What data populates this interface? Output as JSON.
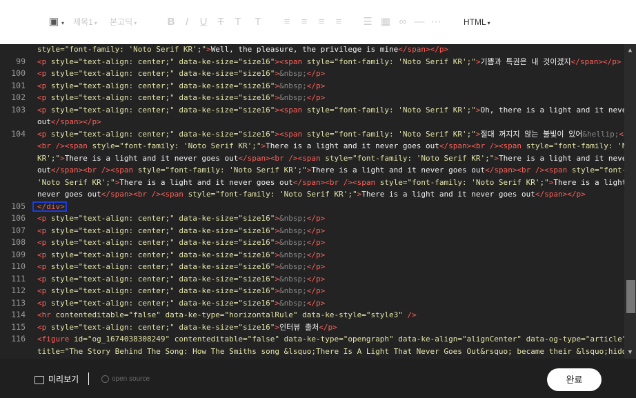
{
  "toolbar": {
    "heading_label": "제목1",
    "font_label": "본고딕",
    "mode_label": "HTML"
  },
  "editor": {
    "lines": [
      {
        "n": "",
        "segs": [
          [
            "attr",
            "style="
          ],
          [
            "str",
            "\"font-family: 'Noto Serif KR';\""
          ],
          [
            "tag",
            ">"
          ],
          [
            "txt",
            "Well, the pleasure, the privilege is mine"
          ],
          [
            "tag",
            "</span></p>"
          ]
        ]
      },
      {
        "n": "99",
        "segs": [
          [
            "tag",
            "<p "
          ],
          [
            "attr",
            "style="
          ],
          [
            "str",
            "\"text-align: center;\" "
          ],
          [
            "attr",
            "data-ke-size="
          ],
          [
            "str",
            "\"size16\""
          ],
          [
            "tag",
            "><span "
          ],
          [
            "attr",
            "style="
          ],
          [
            "str",
            "\"font-family: 'Noto Serif KR';\""
          ],
          [
            "tag",
            ">"
          ],
          [
            "txt",
            "기쁨과 특권은 내 것이겠지"
          ],
          [
            "tag",
            "</span></p>"
          ]
        ]
      },
      {
        "n": "100",
        "segs": [
          [
            "tag",
            "<p "
          ],
          [
            "attr",
            "style="
          ],
          [
            "str",
            "\"text-align: center;\" "
          ],
          [
            "attr",
            "data-ke-size="
          ],
          [
            "str",
            "\"size16\""
          ],
          [
            "tag",
            ">"
          ],
          [
            "ent",
            "&nbsp;"
          ],
          [
            "tag",
            "</p>"
          ]
        ]
      },
      {
        "n": "101",
        "segs": [
          [
            "tag",
            "<p "
          ],
          [
            "attr",
            "style="
          ],
          [
            "str",
            "\"text-align: center;\" "
          ],
          [
            "attr",
            "data-ke-size="
          ],
          [
            "str",
            "\"size16\""
          ],
          [
            "tag",
            ">"
          ],
          [
            "ent",
            "&nbsp;"
          ],
          [
            "tag",
            "</p>"
          ]
        ]
      },
      {
        "n": "102",
        "segs": [
          [
            "tag",
            "<p "
          ],
          [
            "attr",
            "style="
          ],
          [
            "str",
            "\"text-align: center;\" "
          ],
          [
            "attr",
            "data-ke-size="
          ],
          [
            "str",
            "\"size16\""
          ],
          [
            "tag",
            ">"
          ],
          [
            "ent",
            "&nbsp;"
          ],
          [
            "tag",
            "</p>"
          ]
        ]
      },
      {
        "n": "103",
        "segs": [
          [
            "tag",
            "<p "
          ],
          [
            "attr",
            "style="
          ],
          [
            "str",
            "\"text-align: center;\" "
          ],
          [
            "attr",
            "data-ke-size="
          ],
          [
            "str",
            "\"size16\""
          ],
          [
            "tag",
            "><span "
          ],
          [
            "attr",
            "style="
          ],
          [
            "str",
            "\"font-family: 'Noto Serif KR';\""
          ],
          [
            "tag",
            ">"
          ],
          [
            "txt",
            "Oh, there is a light and it never goes"
          ]
        ]
      },
      {
        "n": "",
        "segs": [
          [
            "txt",
            "out"
          ],
          [
            "tag",
            "</span></p>"
          ]
        ]
      },
      {
        "n": "104",
        "segs": [
          [
            "tag",
            "<p "
          ],
          [
            "attr",
            "style="
          ],
          [
            "str",
            "\"text-align: center;\" "
          ],
          [
            "attr",
            "data-ke-size="
          ],
          [
            "str",
            "\"size16\""
          ],
          [
            "tag",
            "><span "
          ],
          [
            "attr",
            "style="
          ],
          [
            "str",
            "\"font-family: 'Noto Serif KR';\""
          ],
          [
            "tag",
            ">"
          ],
          [
            "txt",
            "절대 꺼지지 않는 불빛이 있어"
          ],
          [
            "ent",
            "&hellip;"
          ],
          [
            "tag",
            "</span>"
          ]
        ]
      },
      {
        "n": "",
        "segs": [
          [
            "tag",
            "<br /><span "
          ],
          [
            "attr",
            "style="
          ],
          [
            "str",
            "\"font-family: 'Noto Serif KR';\""
          ],
          [
            "tag",
            ">"
          ],
          [
            "txt",
            "There is a light and it never goes out"
          ],
          [
            "tag",
            "</span><br /><span "
          ],
          [
            "attr",
            "style="
          ],
          [
            "str",
            "\"font-family: 'Noto Serif"
          ]
        ]
      },
      {
        "n": "",
        "segs": [
          [
            "str",
            "KR';\""
          ],
          [
            "tag",
            ">"
          ],
          [
            "txt",
            "There is a light and it never goes out"
          ],
          [
            "tag",
            "</span><br /><span "
          ],
          [
            "attr",
            "style="
          ],
          [
            "str",
            "\"font-family: 'Noto Serif KR';\""
          ],
          [
            "tag",
            ">"
          ],
          [
            "txt",
            "There is a light and it never goes"
          ]
        ]
      },
      {
        "n": "",
        "segs": [
          [
            "txt",
            "out"
          ],
          [
            "tag",
            "</span><br /><span "
          ],
          [
            "attr",
            "style="
          ],
          [
            "str",
            "\"font-family: 'Noto Serif KR';\""
          ],
          [
            "tag",
            ">"
          ],
          [
            "txt",
            "There is a light and it never goes out"
          ],
          [
            "tag",
            "</span><br /><span "
          ],
          [
            "attr",
            "style="
          ],
          [
            "str",
            "\"font-family:"
          ]
        ]
      },
      {
        "n": "",
        "segs": [
          [
            "str",
            "'Noto Serif KR';\""
          ],
          [
            "tag",
            ">"
          ],
          [
            "txt",
            "There is a light and it never goes out"
          ],
          [
            "tag",
            "</span><br /><span "
          ],
          [
            "attr",
            "style="
          ],
          [
            "str",
            "\"font-family: 'Noto Serif KR';\""
          ],
          [
            "tag",
            ">"
          ],
          [
            "txt",
            "There is a light and it"
          ]
        ]
      },
      {
        "n": "",
        "segs": [
          [
            "txt",
            "never goes out"
          ],
          [
            "tag",
            "</span><br /><span "
          ],
          [
            "attr",
            "style="
          ],
          [
            "str",
            "\"font-family: 'Noto Serif KR';\""
          ],
          [
            "tag",
            ">"
          ],
          [
            "txt",
            "There is a light and it never goes out"
          ],
          [
            "tag",
            "</span></p>"
          ]
        ]
      },
      {
        "n": "105",
        "segs": [
          [
            "tag",
            "</div>"
          ]
        ]
      },
      {
        "n": "106",
        "segs": [
          [
            "tag",
            "<p "
          ],
          [
            "attr",
            "style="
          ],
          [
            "str",
            "\"text-align: center;\" "
          ],
          [
            "attr",
            "data-ke-size="
          ],
          [
            "str",
            "\"size16\""
          ],
          [
            "tag",
            ">"
          ],
          [
            "ent",
            "&nbsp;"
          ],
          [
            "tag",
            "</p>"
          ]
        ]
      },
      {
        "n": "107",
        "segs": [
          [
            "tag",
            "<p "
          ],
          [
            "attr",
            "style="
          ],
          [
            "str",
            "\"text-align: center;\" "
          ],
          [
            "attr",
            "data-ke-size="
          ],
          [
            "str",
            "\"size16\""
          ],
          [
            "tag",
            ">"
          ],
          [
            "ent",
            "&nbsp;"
          ],
          [
            "tag",
            "</p>"
          ]
        ]
      },
      {
        "n": "108",
        "segs": [
          [
            "tag",
            "<p "
          ],
          [
            "attr",
            "style="
          ],
          [
            "str",
            "\"text-align: center;\" "
          ],
          [
            "attr",
            "data-ke-size="
          ],
          [
            "str",
            "\"size16\""
          ],
          [
            "tag",
            ">"
          ],
          [
            "ent",
            "&nbsp;"
          ],
          [
            "tag",
            "</p>"
          ]
        ]
      },
      {
        "n": "109",
        "segs": [
          [
            "tag",
            "<p "
          ],
          [
            "attr",
            "style="
          ],
          [
            "str",
            "\"text-align: center;\" "
          ],
          [
            "attr",
            "data-ke-size="
          ],
          [
            "str",
            "\"size16\""
          ],
          [
            "tag",
            ">"
          ],
          [
            "ent",
            "&nbsp;"
          ],
          [
            "tag",
            "</p>"
          ]
        ]
      },
      {
        "n": "110",
        "segs": [
          [
            "tag",
            "<p "
          ],
          [
            "attr",
            "style="
          ],
          [
            "str",
            "\"text-align: center;\" "
          ],
          [
            "attr",
            "data-ke-size="
          ],
          [
            "str",
            "\"size16\""
          ],
          [
            "tag",
            ">"
          ],
          [
            "ent",
            "&nbsp;"
          ],
          [
            "tag",
            "</p>"
          ]
        ]
      },
      {
        "n": "111",
        "segs": [
          [
            "tag",
            "<p "
          ],
          [
            "attr",
            "style="
          ],
          [
            "str",
            "\"text-align: center;\" "
          ],
          [
            "attr",
            "data-ke-size="
          ],
          [
            "str",
            "\"size16\""
          ],
          [
            "tag",
            ">"
          ],
          [
            "ent",
            "&nbsp;"
          ],
          [
            "tag",
            "</p>"
          ]
        ]
      },
      {
        "n": "112",
        "segs": [
          [
            "tag",
            "<p "
          ],
          [
            "attr",
            "style="
          ],
          [
            "str",
            "\"text-align: center;\" "
          ],
          [
            "attr",
            "data-ke-size="
          ],
          [
            "str",
            "\"size16\""
          ],
          [
            "tag",
            ">"
          ],
          [
            "ent",
            "&nbsp;"
          ],
          [
            "tag",
            "</p>"
          ]
        ]
      },
      {
        "n": "113",
        "segs": [
          [
            "tag",
            "<p "
          ],
          [
            "attr",
            "style="
          ],
          [
            "str",
            "\"text-align: center;\" "
          ],
          [
            "attr",
            "data-ke-size="
          ],
          [
            "str",
            "\"size16\""
          ],
          [
            "tag",
            ">"
          ],
          [
            "ent",
            "&nbsp;"
          ],
          [
            "tag",
            "</p>"
          ]
        ]
      },
      {
        "n": "114",
        "segs": [
          [
            "tag",
            "<hr "
          ],
          [
            "attr",
            "contenteditable="
          ],
          [
            "str",
            "\"false\" "
          ],
          [
            "attr",
            "data-ke-type="
          ],
          [
            "str",
            "\"horizontalRule\" "
          ],
          [
            "attr",
            "data-ke-style="
          ],
          [
            "str",
            "\"style3\" "
          ],
          [
            "tag",
            "/>"
          ]
        ]
      },
      {
        "n": "115",
        "segs": [
          [
            "tag",
            "<p "
          ],
          [
            "attr",
            "style="
          ],
          [
            "str",
            "\"text-align: center;\" "
          ],
          [
            "attr",
            "data-ke-size="
          ],
          [
            "str",
            "\"size16\""
          ],
          [
            "tag",
            ">"
          ],
          [
            "txt",
            "인터뷰 출처"
          ],
          [
            "tag",
            "</p>"
          ]
        ]
      },
      {
        "n": "116",
        "segs": [
          [
            "tag",
            "<figure "
          ],
          [
            "attr",
            "id="
          ],
          [
            "str",
            "\"og_1674038308249\" "
          ],
          [
            "attr",
            "contenteditable="
          ],
          [
            "str",
            "\"false\" "
          ],
          [
            "attr",
            "data-ke-type="
          ],
          [
            "str",
            "\"opengraph\" "
          ],
          [
            "attr",
            "data-ke-align="
          ],
          [
            "str",
            "\"alignCenter\" "
          ],
          [
            "attr",
            "data-og-type="
          ],
          [
            "str",
            "\"article\" "
          ],
          [
            "attr",
            "data-og-"
          ]
        ]
      },
      {
        "n": "",
        "segs": [
          [
            "attr",
            "title="
          ],
          [
            "str",
            "\"The Story Behind The Song: How The Smiths song &lsquo;There Is A Light That Never Goes Out&rsquo; became their &lsquo;hidden"
          ]
        ]
      }
    ]
  },
  "footer": {
    "preview_label": "미리보기",
    "opensource_label": "open source",
    "done_label": "완료"
  },
  "colors": {
    "tag": "#ff5f58",
    "attr": "#e4e4a8",
    "text": "#f1f1f1",
    "highlight": "#1b3ddb"
  }
}
